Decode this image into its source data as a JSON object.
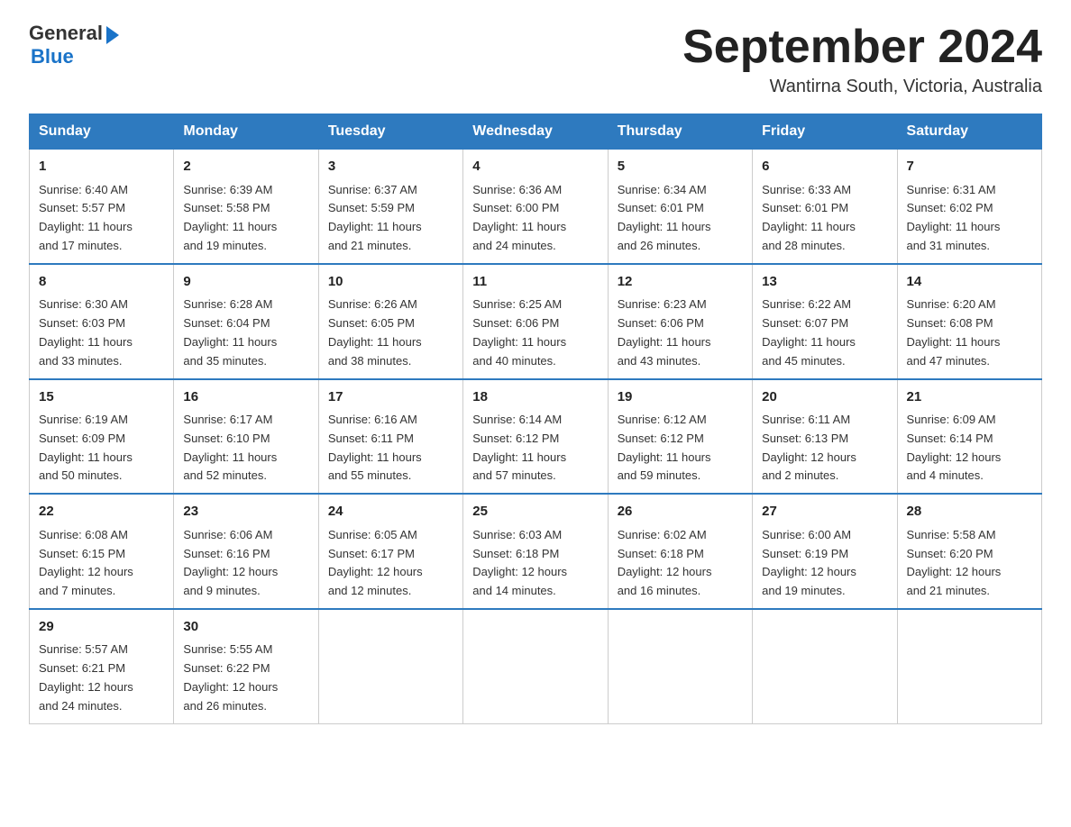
{
  "header": {
    "logo_general": "General",
    "logo_blue": "Blue",
    "title": "September 2024",
    "subtitle": "Wantirna South, Victoria, Australia"
  },
  "days_of_week": [
    "Sunday",
    "Monday",
    "Tuesday",
    "Wednesday",
    "Thursday",
    "Friday",
    "Saturday"
  ],
  "weeks": [
    [
      {
        "day": "1",
        "sunrise": "6:40 AM",
        "sunset": "5:57 PM",
        "daylight": "11 hours and 17 minutes."
      },
      {
        "day": "2",
        "sunrise": "6:39 AM",
        "sunset": "5:58 PM",
        "daylight": "11 hours and 19 minutes."
      },
      {
        "day": "3",
        "sunrise": "6:37 AM",
        "sunset": "5:59 PM",
        "daylight": "11 hours and 21 minutes."
      },
      {
        "day": "4",
        "sunrise": "6:36 AM",
        "sunset": "6:00 PM",
        "daylight": "11 hours and 24 minutes."
      },
      {
        "day": "5",
        "sunrise": "6:34 AM",
        "sunset": "6:01 PM",
        "daylight": "11 hours and 26 minutes."
      },
      {
        "day": "6",
        "sunrise": "6:33 AM",
        "sunset": "6:01 PM",
        "daylight": "11 hours and 28 minutes."
      },
      {
        "day": "7",
        "sunrise": "6:31 AM",
        "sunset": "6:02 PM",
        "daylight": "11 hours and 31 minutes."
      }
    ],
    [
      {
        "day": "8",
        "sunrise": "6:30 AM",
        "sunset": "6:03 PM",
        "daylight": "11 hours and 33 minutes."
      },
      {
        "day": "9",
        "sunrise": "6:28 AM",
        "sunset": "6:04 PM",
        "daylight": "11 hours and 35 minutes."
      },
      {
        "day": "10",
        "sunrise": "6:26 AM",
        "sunset": "6:05 PM",
        "daylight": "11 hours and 38 minutes."
      },
      {
        "day": "11",
        "sunrise": "6:25 AM",
        "sunset": "6:06 PM",
        "daylight": "11 hours and 40 minutes."
      },
      {
        "day": "12",
        "sunrise": "6:23 AM",
        "sunset": "6:06 PM",
        "daylight": "11 hours and 43 minutes."
      },
      {
        "day": "13",
        "sunrise": "6:22 AM",
        "sunset": "6:07 PM",
        "daylight": "11 hours and 45 minutes."
      },
      {
        "day": "14",
        "sunrise": "6:20 AM",
        "sunset": "6:08 PM",
        "daylight": "11 hours and 47 minutes."
      }
    ],
    [
      {
        "day": "15",
        "sunrise": "6:19 AM",
        "sunset": "6:09 PM",
        "daylight": "11 hours and 50 minutes."
      },
      {
        "day": "16",
        "sunrise": "6:17 AM",
        "sunset": "6:10 PM",
        "daylight": "11 hours and 52 minutes."
      },
      {
        "day": "17",
        "sunrise": "6:16 AM",
        "sunset": "6:11 PM",
        "daylight": "11 hours and 55 minutes."
      },
      {
        "day": "18",
        "sunrise": "6:14 AM",
        "sunset": "6:12 PM",
        "daylight": "11 hours and 57 minutes."
      },
      {
        "day": "19",
        "sunrise": "6:12 AM",
        "sunset": "6:12 PM",
        "daylight": "11 hours and 59 minutes."
      },
      {
        "day": "20",
        "sunrise": "6:11 AM",
        "sunset": "6:13 PM",
        "daylight": "12 hours and 2 minutes."
      },
      {
        "day": "21",
        "sunrise": "6:09 AM",
        "sunset": "6:14 PM",
        "daylight": "12 hours and 4 minutes."
      }
    ],
    [
      {
        "day": "22",
        "sunrise": "6:08 AM",
        "sunset": "6:15 PM",
        "daylight": "12 hours and 7 minutes."
      },
      {
        "day": "23",
        "sunrise": "6:06 AM",
        "sunset": "6:16 PM",
        "daylight": "12 hours and 9 minutes."
      },
      {
        "day": "24",
        "sunrise": "6:05 AM",
        "sunset": "6:17 PM",
        "daylight": "12 hours and 12 minutes."
      },
      {
        "day": "25",
        "sunrise": "6:03 AM",
        "sunset": "6:18 PM",
        "daylight": "12 hours and 14 minutes."
      },
      {
        "day": "26",
        "sunrise": "6:02 AM",
        "sunset": "6:18 PM",
        "daylight": "12 hours and 16 minutes."
      },
      {
        "day": "27",
        "sunrise": "6:00 AM",
        "sunset": "6:19 PM",
        "daylight": "12 hours and 19 minutes."
      },
      {
        "day": "28",
        "sunrise": "5:58 AM",
        "sunset": "6:20 PM",
        "daylight": "12 hours and 21 minutes."
      }
    ],
    [
      {
        "day": "29",
        "sunrise": "5:57 AM",
        "sunset": "6:21 PM",
        "daylight": "12 hours and 24 minutes."
      },
      {
        "day": "30",
        "sunrise": "5:55 AM",
        "sunset": "6:22 PM",
        "daylight": "12 hours and 26 minutes."
      },
      null,
      null,
      null,
      null,
      null
    ]
  ],
  "labels": {
    "sunrise": "Sunrise:",
    "sunset": "Sunset:",
    "daylight": "Daylight:"
  }
}
